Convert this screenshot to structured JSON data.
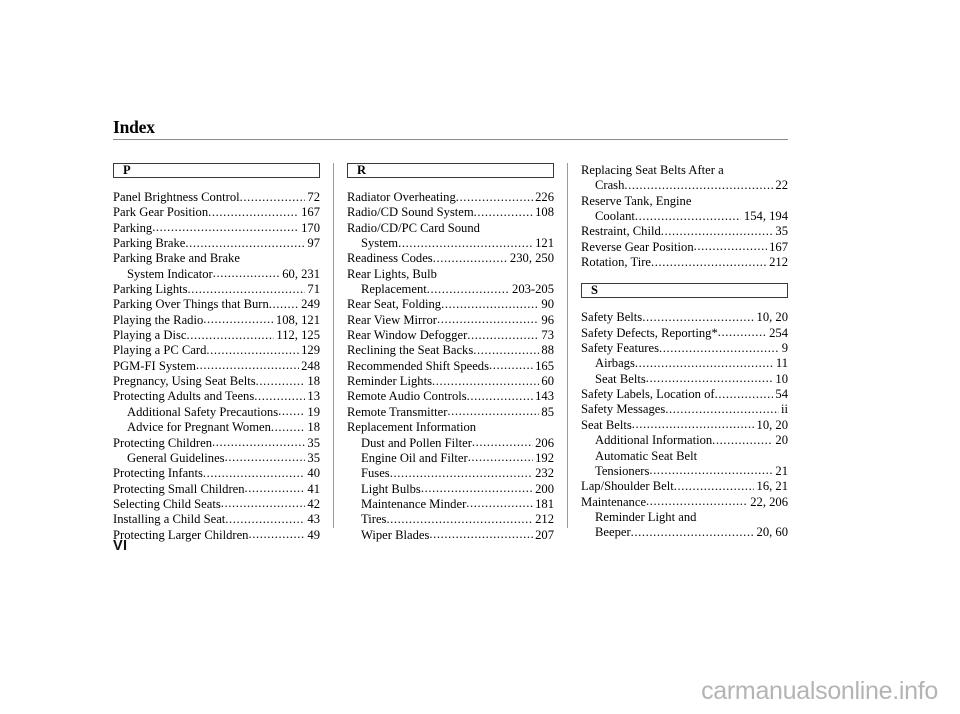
{
  "document": {
    "title": "Index",
    "page_number": "VI",
    "watermark": "carmanualsonline.info"
  },
  "columns": [
    {
      "sections": [
        {
          "letter": "P",
          "entries": [
            {
              "label": "Panel Brightness Control",
              "pages": "72",
              "sub": false,
              "leader": true
            },
            {
              "label": "Park Gear Position",
              "pages": "167",
              "sub": false,
              "leader": true
            },
            {
              "label": "Parking",
              "pages": "170",
              "sub": false,
              "leader": true
            },
            {
              "label": "Parking Brake",
              "pages": "97",
              "sub": false,
              "leader": true
            },
            {
              "label": "Parking Brake and Brake",
              "pages": "",
              "sub": false,
              "leader": false
            },
            {
              "label": "System Indicator",
              "pages": "60, 231",
              "sub": true,
              "leader": true
            },
            {
              "label": "Parking Lights",
              "pages": "71",
              "sub": false,
              "leader": true
            },
            {
              "label": "Parking Over Things that Burn",
              "pages": "249",
              "sub": false,
              "leader": true
            },
            {
              "label": "Playing the Radio",
              "pages": "108, 121",
              "sub": false,
              "leader": true
            },
            {
              "label": "Playing a Disc",
              "pages": "112, 125",
              "sub": false,
              "leader": true
            },
            {
              "label": "Playing a PC Card",
              "pages": "129",
              "sub": false,
              "leader": true
            },
            {
              "label": "PGM-FI System",
              "pages": "248",
              "sub": false,
              "leader": true
            },
            {
              "label": "Pregnancy, Using Seat Belts",
              "pages": "18",
              "sub": false,
              "leader": true
            },
            {
              "label": "Protecting Adults and Teens",
              "pages": "13",
              "sub": false,
              "leader": true
            },
            {
              "label": "Additional Safety Precautions",
              "pages": "19",
              "sub": true,
              "leader": true
            },
            {
              "label": "Advice for Pregnant Women",
              "pages": "18",
              "sub": true,
              "leader": true
            },
            {
              "label": "Protecting Children",
              "pages": "35",
              "sub": false,
              "leader": true
            },
            {
              "label": "General Guidelines",
              "pages": "35",
              "sub": true,
              "leader": true
            },
            {
              "label": "Protecting Infants",
              "pages": "40",
              "sub": false,
              "leader": true
            },
            {
              "label": "Protecting Small Children",
              "pages": "41",
              "sub": false,
              "leader": true
            },
            {
              "label": "Selecting Child Seats",
              "pages": "42",
              "sub": false,
              "leader": true
            },
            {
              "label": "Installing a Child Seat",
              "pages": "43",
              "sub": false,
              "leader": true
            },
            {
              "label": "Protecting Larger Children",
              "pages": "49",
              "sub": false,
              "leader": true
            }
          ]
        }
      ]
    },
    {
      "sections": [
        {
          "letter": "R",
          "entries": [
            {
              "label": "Radiator Overheating",
              "pages": "226",
              "sub": false,
              "leader": true
            },
            {
              "label": "Radio/CD Sound System",
              "pages": "108",
              "sub": false,
              "leader": true
            },
            {
              "label": "Radio/CD/PC Card Sound",
              "pages": "",
              "sub": false,
              "leader": false
            },
            {
              "label": "System",
              "pages": "121",
              "sub": true,
              "leader": true
            },
            {
              "label": "Readiness Codes",
              "pages": "230, 250",
              "sub": false,
              "leader": true
            },
            {
              "label": "Rear Lights, Bulb",
              "pages": "",
              "sub": false,
              "leader": false
            },
            {
              "label": "Replacement",
              "pages": "203-205",
              "sub": true,
              "leader": true
            },
            {
              "label": "Rear Seat, Folding",
              "pages": "90",
              "sub": false,
              "leader": true
            },
            {
              "label": "Rear View Mirror",
              "pages": "96",
              "sub": false,
              "leader": true
            },
            {
              "label": "Rear Window Defogger",
              "pages": "73",
              "sub": false,
              "leader": true
            },
            {
              "label": "Reclining the Seat Backs",
              "pages": "88",
              "sub": false,
              "leader": true
            },
            {
              "label": "Recommended Shift Speeds",
              "pages": "165",
              "sub": false,
              "leader": true
            },
            {
              "label": "Reminder Lights",
              "pages": "60",
              "sub": false,
              "leader": true
            },
            {
              "label": "Remote Audio Controls",
              "pages": "143",
              "sub": false,
              "leader": true
            },
            {
              "label": "Remote Transmitter",
              "pages": "85",
              "sub": false,
              "leader": true
            },
            {
              "label": "Replacement Information",
              "pages": "",
              "sub": false,
              "leader": false
            },
            {
              "label": "Dust and Pollen Filter",
              "pages": "206",
              "sub": true,
              "leader": true
            },
            {
              "label": "Engine Oil and Filter",
              "pages": "192",
              "sub": true,
              "leader": true
            },
            {
              "label": "Fuses",
              "pages": "232",
              "sub": true,
              "leader": true
            },
            {
              "label": "Light Bulbs",
              "pages": "200",
              "sub": true,
              "leader": true
            },
            {
              "label": "Maintenance Minder",
              "pages": "181",
              "sub": true,
              "leader": true
            },
            {
              "label": "Tires",
              "pages": "212",
              "sub": true,
              "leader": true
            },
            {
              "label": "Wiper Blades",
              "pages": "207",
              "sub": true,
              "leader": true
            }
          ]
        }
      ]
    },
    {
      "sections": [
        {
          "letter": "",
          "entries": [
            {
              "label": "Replacing Seat Belts After a",
              "pages": "",
              "sub": false,
              "leader": false
            },
            {
              "label": "Crash",
              "pages": "22",
              "sub": true,
              "leader": true
            },
            {
              "label": "Reserve Tank, Engine",
              "pages": "",
              "sub": false,
              "leader": false
            },
            {
              "label": "Coolant",
              "pages": "154, 194",
              "sub": true,
              "leader": true
            },
            {
              "label": "Restraint, Child",
              "pages": "35",
              "sub": false,
              "leader": true
            },
            {
              "label": "Reverse Gear Position",
              "pages": "167",
              "sub": false,
              "leader": true
            },
            {
              "label": "Rotation, Tire",
              "pages": "212",
              "sub": false,
              "leader": true
            }
          ]
        },
        {
          "letter": "S",
          "entries": [
            {
              "label": "Safety Belts",
              "pages": "10, 20",
              "sub": false,
              "leader": true
            },
            {
              "label": "Safety Defects, Reporting*",
              "pages": "254",
              "sub": false,
              "leader": true
            },
            {
              "label": "Safety Features",
              "pages": "9",
              "sub": false,
              "leader": true
            },
            {
              "label": "Airbags",
              "pages": "11",
              "sub": true,
              "leader": true
            },
            {
              "label": "Seat Belts",
              "pages": "10",
              "sub": true,
              "leader": true
            },
            {
              "label": "Safety Labels, Location of",
              "pages": "54",
              "sub": false,
              "leader": true
            },
            {
              "label": "Safety Messages",
              "pages": "ii",
              "sub": false,
              "leader": true
            },
            {
              "label": "Seat Belts",
              "pages": "10, 20",
              "sub": false,
              "leader": true
            },
            {
              "label": "Additional Information",
              "pages": "20",
              "sub": true,
              "leader": true
            },
            {
              "label": "Automatic Seat Belt",
              "pages": "",
              "sub": true,
              "leader": false
            },
            {
              "label": "Tensioners",
              "pages": "21",
              "sub": true,
              "leader": true
            },
            {
              "label": "Lap/Shoulder Belt",
              "pages": "16, 21",
              "sub": false,
              "leader": true
            },
            {
              "label": "Maintenance",
              "pages": "22, 206",
              "sub": false,
              "leader": true
            },
            {
              "label": "Reminder Light and",
              "pages": "",
              "sub": true,
              "leader": false
            },
            {
              "label": "Beeper",
              "pages": "20, 60",
              "sub": true,
              "leader": true
            }
          ]
        }
      ]
    }
  ]
}
